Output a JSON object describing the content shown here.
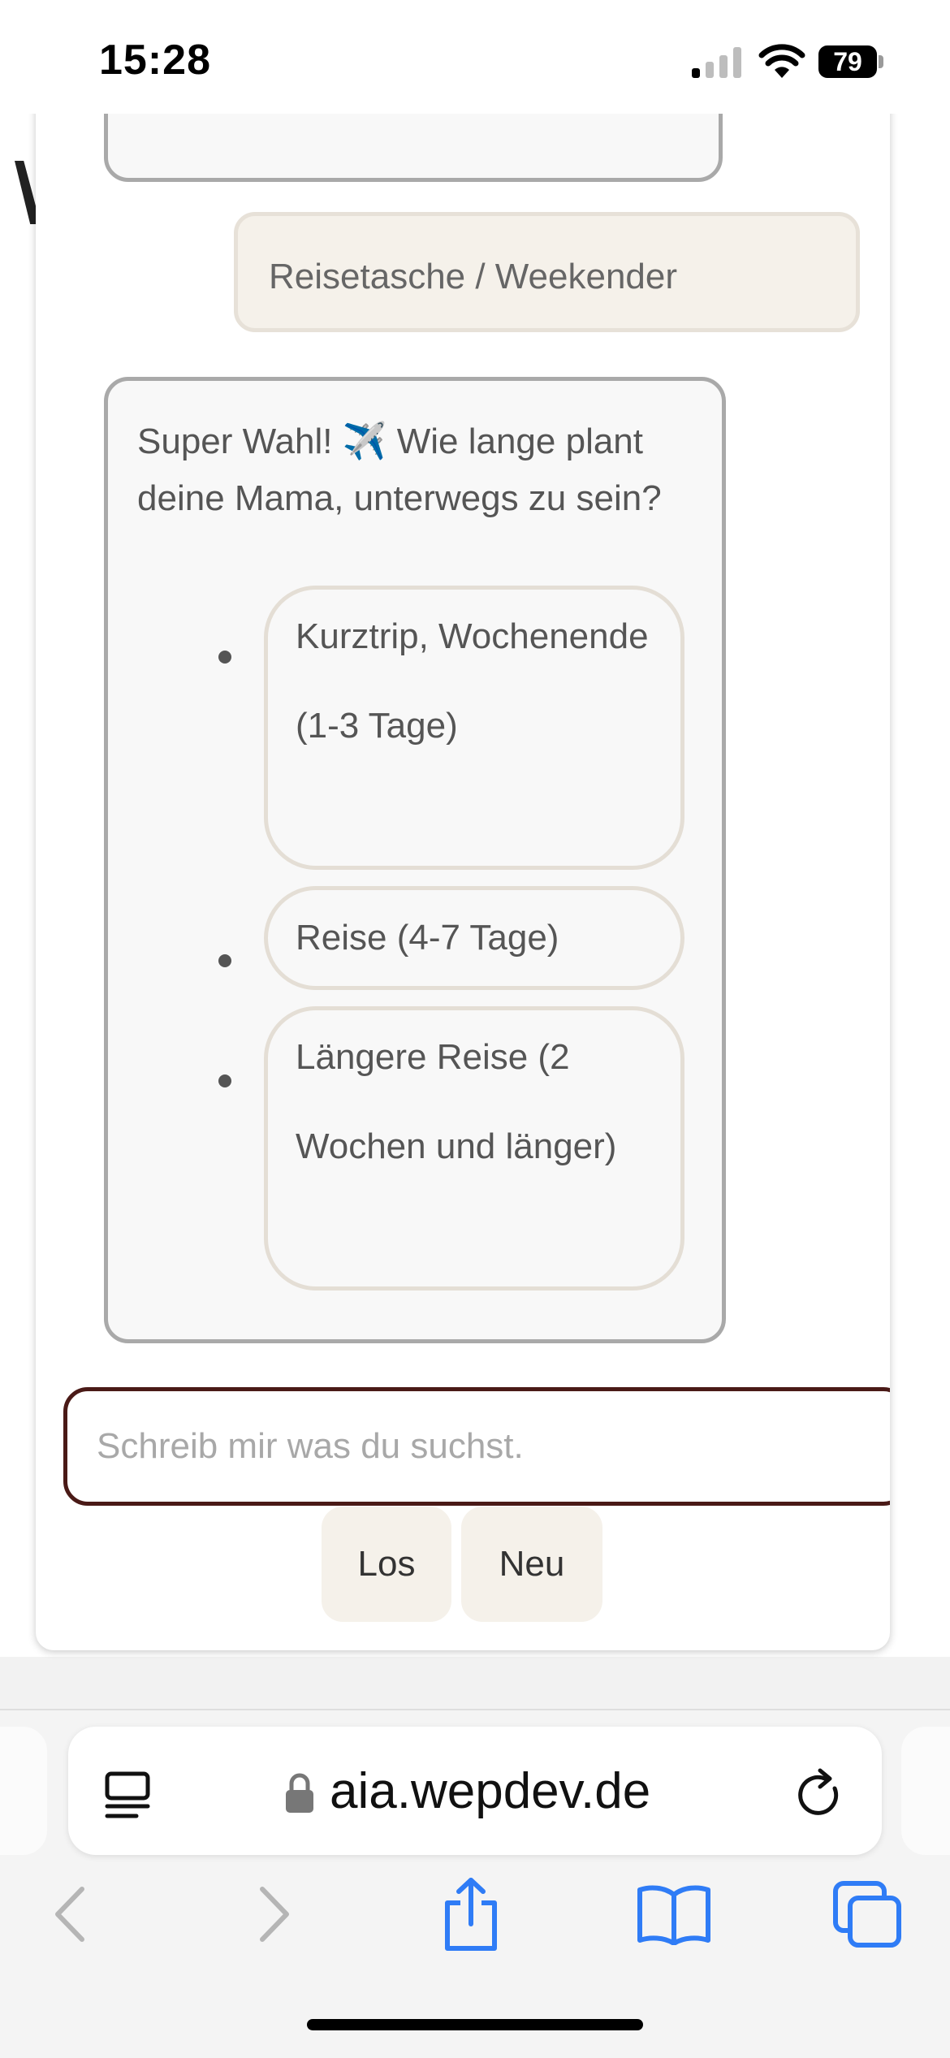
{
  "status_bar": {
    "time": "15:28",
    "battery": "79"
  },
  "chat": {
    "user_message": "Reisetasche / Weekender",
    "bot_message": "Super Wahl! ✈️ Wie lange plant deine Mama, unterwegs zu sein?",
    "options": [
      "Kurztrip, Wochenende (1-3 Tage)",
      "Reise (4-7 Tage)",
      "Längere Reise (2 Wochen und länger)"
    ],
    "input_placeholder": "Schreib mir was du suchst.",
    "send_label": "Los",
    "new_label": "Neu"
  },
  "browser": {
    "url": "aia.wepdev.de"
  },
  "colors": {
    "input_border": "#4a1a17",
    "bubble_user_bg": "#f5f1ea",
    "bubble_bot_border": "#a9a9a9",
    "safari_blue": "#2f7cf6"
  }
}
